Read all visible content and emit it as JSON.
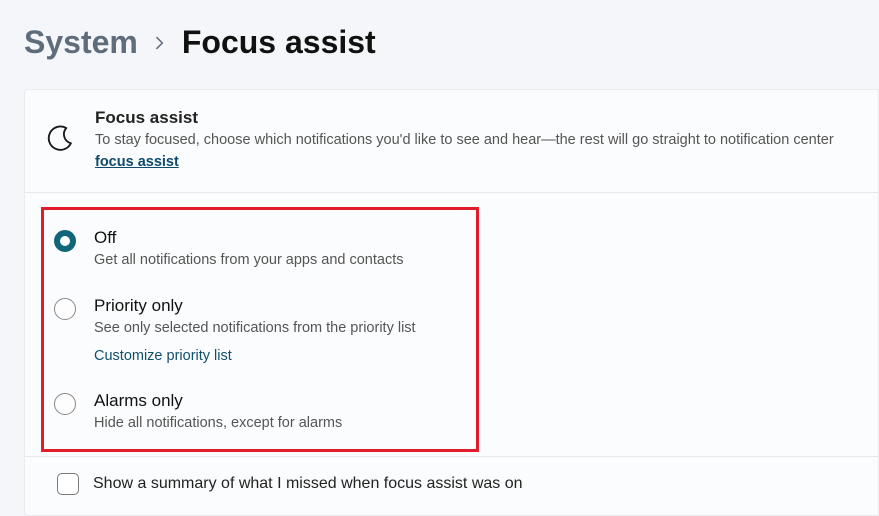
{
  "breadcrumb": {
    "parent": "System",
    "current": "Focus assist"
  },
  "header": {
    "title": "Focus assist",
    "desc_prefix": "To stay focused, choose which notifications you'd like to see and hear—the rest will go straight to notification center",
    "link_label": "focus assist"
  },
  "options": [
    {
      "key": "off",
      "title": "Off",
      "desc": "Get all notifications from your apps and contacts",
      "selected": true
    },
    {
      "key": "priority",
      "title": "Priority only",
      "desc": "See only selected notifications from the priority list",
      "link": "Customize priority list",
      "selected": false
    },
    {
      "key": "alarms",
      "title": "Alarms only",
      "desc": "Hide all notifications, except for alarms",
      "selected": false
    }
  ],
  "summary": {
    "label": "Show a summary of what I missed when focus assist was on",
    "checked": false
  }
}
